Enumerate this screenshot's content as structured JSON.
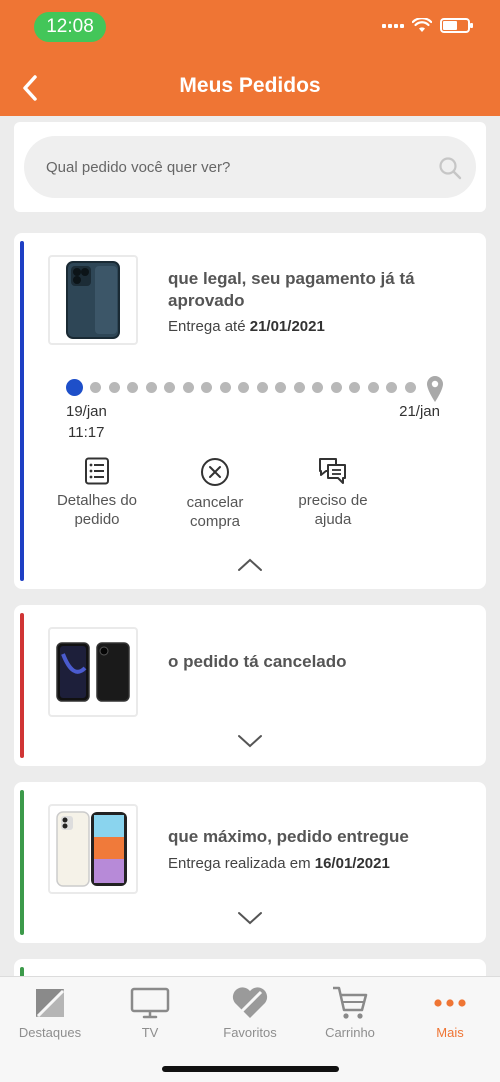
{
  "status_bar": {
    "time": "12:08"
  },
  "header": {
    "title": "Meus Pedidos"
  },
  "search": {
    "placeholder": "Qual pedido você quer ver?"
  },
  "orders": [
    {
      "status_text": "que legal, seu pagamento já tá aprovado",
      "delivery_prefix": "Entrega até ",
      "delivery_date": "21/01/2021",
      "status_color": "#1e3fc4",
      "timeline": {
        "start_date": "19/jan",
        "start_time": "11:17",
        "end_date": "21/jan"
      },
      "actions": [
        {
          "label": "Detalhes do pedido",
          "icon": "list-icon"
        },
        {
          "label": "cancelar compra",
          "icon": "cancel-circle-icon"
        },
        {
          "label": "preciso de ajuda",
          "icon": "chat-icon"
        }
      ]
    },
    {
      "status_text": "o pedido tá cancelado",
      "status_color": "#d03535"
    },
    {
      "status_text": "que máximo, pedido entregue",
      "delivery_prefix": "Entrega realizada em ",
      "delivery_date": "16/01/2021",
      "status_color": "#3c9a4a"
    }
  ],
  "tabbar": {
    "tabs": [
      {
        "label": "Destaques",
        "icon": "destaques-icon"
      },
      {
        "label": "TV",
        "icon": "tv-icon"
      },
      {
        "label": "Favoritos",
        "icon": "heart-icon"
      },
      {
        "label": "Carrinho",
        "icon": "cart-icon"
      },
      {
        "label": "Mais",
        "icon": "more-dots-icon",
        "active": true
      }
    ]
  },
  "colors": {
    "brand": "#ef7534",
    "active_tab": "#ef7534"
  }
}
